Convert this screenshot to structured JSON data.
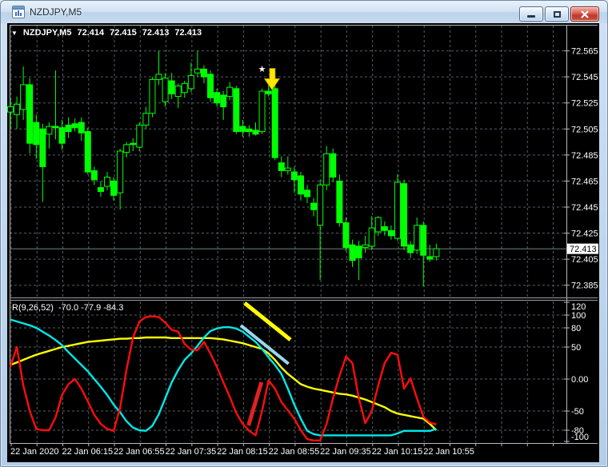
{
  "window": {
    "title": "NZDJPY,M5"
  },
  "icons": {
    "dropdown_glyph": "▼",
    "star_glyph": "★"
  },
  "chart_header": {
    "symbol": "NZDJPY,M5",
    "open": "72.414",
    "high": "72.415",
    "low": "72.413",
    "close": "72.413"
  },
  "price_axis": {
    "labels": [
      "72.565",
      "72.545",
      "72.525",
      "72.505",
      "72.485",
      "72.465",
      "72.445",
      "72.425",
      "72.405",
      "72.385"
    ],
    "current_price": "72.413"
  },
  "time_axis": {
    "labels": [
      "22 Jan 2020",
      "22 Jan 06:15",
      "22 Jan 06:55",
      "22 Jan 07:35",
      "22 Jan 08:15",
      "22 Jan 08:55",
      "22 Jan 09:35",
      "22 Jan 10:15",
      "22 Jan 10:55"
    ]
  },
  "indicator_header": {
    "name": "R(9,26,52)",
    "values": "-70.0 -77.9 -84.3"
  },
  "indicator_axis": {
    "labels": [
      "120",
      "100",
      "80",
      "50",
      "0.00",
      "-50",
      "-80",
      "-100"
    ],
    "gridline_values": [
      100,
      80,
      50,
      0,
      -50,
      -80
    ]
  },
  "colors": {
    "candle": "#00ff00",
    "bull_fill": "#000000",
    "wpr_fast": "#ff0d0d",
    "wpr_mid": "#00e8e8",
    "wpr_slow": "#ffff00",
    "annotation_yellow": "#ffff00",
    "annotation_blue": "#9cd6ee",
    "annotation_red": "#e02222",
    "star": "#ffff00",
    "arrow": "#ffe800",
    "grid": "#545e64",
    "frame": "#b6babd",
    "text": "#ffffff",
    "bid_line": "#708080",
    "badge_bg": "#ffffff",
    "badge_text": "#000000",
    "panel_bg": "#000000"
  },
  "chart_data": {
    "type": "candlestick_with_oscillator",
    "symbol": "NZDJPY",
    "timeframe": "M5",
    "price_axis_range": [
      72.385,
      72.565
    ],
    "price_gridline_step": 0.02,
    "oscillator_axis_range": [
      -100,
      120
    ],
    "candles": [
      [
        72.518,
        72.528,
        72.506,
        72.522
      ],
      [
        72.516,
        72.53,
        72.505,
        72.524
      ],
      [
        72.52,
        72.553,
        72.512,
        72.539
      ],
      [
        72.539,
        72.544,
        72.486,
        72.494
      ],
      [
        72.51,
        72.516,
        72.482,
        72.493
      ],
      [
        72.505,
        72.509,
        72.449,
        72.476
      ],
      [
        72.501,
        72.51,
        72.49,
        72.507
      ],
      [
        72.507,
        72.55,
        72.497,
        72.506
      ],
      [
        72.506,
        72.512,
        72.489,
        72.494
      ],
      [
        72.508,
        72.514,
        72.498,
        72.503
      ],
      [
        72.509,
        72.513,
        72.503,
        72.506
      ],
      [
        72.51,
        72.514,
        72.496,
        72.502
      ],
      [
        72.503,
        72.506,
        72.47,
        72.472
      ],
      [
        72.473,
        72.476,
        72.462,
        72.466
      ],
      [
        72.46,
        72.465,
        72.453,
        72.457
      ],
      [
        72.461,
        72.472,
        72.458,
        72.468
      ],
      [
        72.465,
        72.468,
        72.45,
        72.454
      ],
      [
        72.456,
        72.49,
        72.443,
        72.488
      ],
      [
        72.487,
        72.495,
        72.483,
        72.493
      ],
      [
        72.494,
        72.498,
        72.488,
        72.493
      ],
      [
        72.491,
        72.51,
        72.488,
        72.508
      ],
      [
        72.508,
        72.522,
        72.505,
        72.517
      ],
      [
        72.517,
        72.545,
        72.514,
        72.543
      ],
      [
        72.543,
        72.565,
        72.539,
        72.547
      ],
      [
        72.526,
        72.548,
        72.522,
        72.544
      ],
      [
        72.542,
        72.548,
        72.528,
        72.532
      ],
      [
        72.53,
        72.54,
        72.521,
        72.538
      ],
      [
        72.533,
        72.542,
        72.529,
        72.54
      ],
      [
        72.536,
        72.556,
        72.533,
        72.546
      ],
      [
        72.548,
        72.565,
        72.545,
        72.551
      ],
      [
        72.551,
        72.554,
        72.54,
        72.545
      ],
      [
        72.547,
        72.55,
        72.526,
        72.529
      ],
      [
        72.533,
        72.536,
        72.522,
        72.525
      ],
      [
        72.531,
        72.534,
        72.512,
        72.522
      ],
      [
        72.53,
        72.541,
        72.527,
        72.537
      ],
      [
        72.536,
        72.538,
        72.501,
        72.503
      ],
      [
        72.507,
        72.512,
        72.499,
        72.503
      ],
      [
        72.505,
        72.508,
        72.499,
        72.503
      ],
      [
        72.504,
        72.51,
        72.5,
        72.501
      ],
      [
        72.503,
        72.536,
        72.501,
        72.534
      ],
      [
        72.534,
        72.541,
        72.53,
        72.532
      ],
      [
        72.536,
        72.539,
        72.481,
        72.483
      ],
      [
        72.479,
        72.484,
        72.468,
        72.473
      ],
      [
        72.473,
        72.484,
        72.47,
        72.475
      ],
      [
        72.472,
        72.476,
        72.456,
        72.466
      ],
      [
        72.469,
        72.472,
        72.45,
        72.455
      ],
      [
        72.458,
        72.462,
        72.448,
        72.453
      ],
      [
        72.448,
        72.452,
        72.438,
        72.443
      ],
      [
        72.431,
        72.466,
        72.389,
        72.462
      ],
      [
        72.462,
        72.492,
        72.458,
        72.486
      ],
      [
        72.486,
        72.49,
        72.464,
        72.468
      ],
      [
        72.465,
        72.47,
        72.43,
        72.433
      ],
      [
        72.433,
        72.437,
        72.411,
        72.414
      ],
      [
        72.416,
        72.42,
        72.399,
        72.404
      ],
      [
        72.415,
        72.419,
        72.389,
        72.406
      ],
      [
        72.414,
        72.423,
        72.41,
        72.416
      ],
      [
        72.415,
        72.438,
        72.412,
        72.429
      ],
      [
        72.426,
        72.438,
        72.423,
        72.437
      ],
      [
        72.43,
        72.434,
        72.423,
        72.427
      ],
      [
        72.427,
        72.431,
        72.42,
        72.423
      ],
      [
        72.421,
        72.47,
        72.419,
        72.464
      ],
      [
        72.463,
        72.466,
        72.412,
        72.415
      ],
      [
        72.416,
        72.419,
        72.406,
        72.41
      ],
      [
        72.412,
        72.437,
        72.409,
        72.431
      ],
      [
        72.431,
        72.434,
        72.384,
        72.408
      ],
      [
        72.407,
        72.416,
        72.403,
        72.405
      ],
      [
        72.407,
        72.417,
        72.404,
        72.413
      ]
    ],
    "oscillator": {
      "name": "R(9,26,52)",
      "series": [
        {
          "name": "slow-52",
          "color_key": "wpr_slow",
          "values": [
            22,
            26,
            30,
            34,
            38,
            41,
            44,
            47,
            50,
            52,
            54,
            56,
            58,
            59,
            60,
            61,
            62,
            63,
            63,
            64,
            64,
            65,
            65,
            65,
            65,
            64,
            64,
            64,
            64,
            64,
            64,
            64,
            63,
            62,
            60,
            58,
            56,
            53,
            50,
            47,
            40,
            30,
            18,
            8,
            0,
            -8,
            -12,
            -15,
            -17,
            -19,
            -21,
            -23,
            -24,
            -26,
            -29,
            -32,
            -36,
            -40,
            -44,
            -50,
            -54,
            -56,
            -58,
            -60,
            -62,
            -70,
            -80
          ]
        },
        {
          "name": "mid-26",
          "color_key": "wpr_mid",
          "values": [
            93,
            90,
            87,
            84,
            80,
            74,
            68,
            61,
            53,
            42,
            32,
            22,
            12,
            0,
            -12,
            -25,
            -40,
            -52,
            -66,
            -76,
            -80,
            -81,
            -73,
            -55,
            -30,
            -5,
            14,
            30,
            40,
            52,
            65,
            75,
            79,
            81,
            81,
            79,
            74,
            66,
            58,
            47,
            34,
            22,
            8,
            -15,
            -40,
            -62,
            -81,
            -86,
            -88,
            -88,
            -88,
            -88,
            -88,
            -88,
            -88,
            -88,
            -88,
            -88,
            -88,
            -88,
            -85,
            -81,
            -81,
            -81,
            -81,
            -81,
            -78
          ]
        },
        {
          "name": "fast-9",
          "color_key": "wpr_fast",
          "values": [
            19,
            50,
            -10,
            -50,
            -78,
            -80,
            -80,
            -60,
            -25,
            -8,
            0,
            -15,
            -35,
            -56,
            -70,
            -78,
            -81,
            -45,
            15,
            65,
            90,
            97,
            98,
            97,
            88,
            77,
            74,
            55,
            46,
            45,
            58,
            40,
            19,
            -5,
            -28,
            -53,
            -70,
            -81,
            -88,
            -50,
            -2,
            -15,
            -36,
            -49,
            -62,
            -80,
            -94,
            -96,
            -96,
            -70,
            -30,
            5,
            35,
            25,
            -30,
            -69,
            -50,
            -10,
            25,
            41,
            38,
            -15,
            1,
            -30,
            -59,
            -68,
            -71
          ]
        }
      ]
    },
    "annotations": {
      "star": {
        "bar": 39.5,
        "price": 72.553
      },
      "arrow": {
        "bar": 40.6,
        "price_top": 72.5515,
        "price_tip": 72.535
      },
      "trend_lines": [
        {
          "color_key": "annotation_yellow",
          "panel": "oscillator",
          "x1_bar": 36.3,
          "v1": 118.8,
          "x2_bar": 43.4,
          "v2": 61.3,
          "width": 5
        },
        {
          "color_key": "annotation_blue",
          "panel": "oscillator",
          "x1_bar": 35.7,
          "v1": 83.8,
          "x2_bar": 43.1,
          "v2": 23.8,
          "width": 4
        },
        {
          "color_key": "annotation_red",
          "panel": "oscillator",
          "x1_bar": 36.9,
          "v1": -72.5,
          "x2_bar": 38.9,
          "v2": -5,
          "width": 5
        }
      ]
    }
  }
}
